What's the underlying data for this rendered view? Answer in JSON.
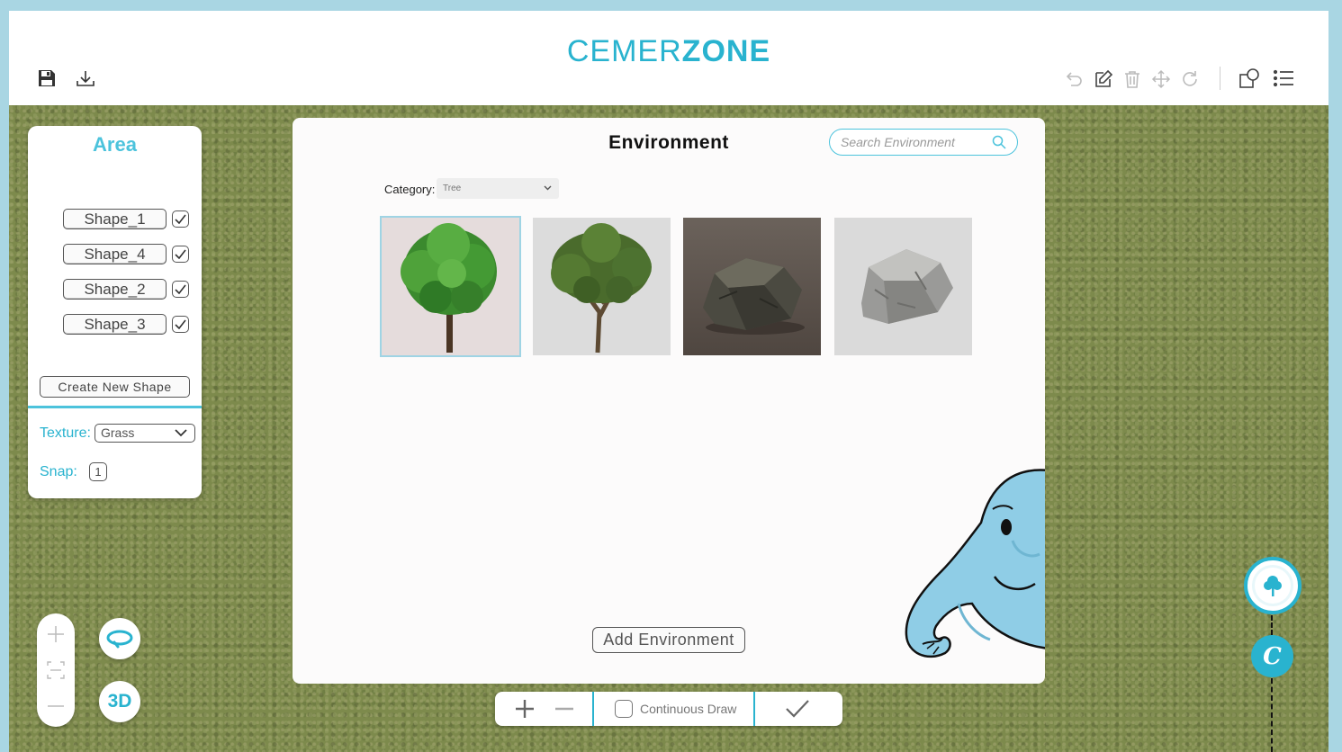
{
  "app": {
    "logo_light": "CEMER",
    "logo_bold": "ZONE",
    "accent_color": "#29b3cf",
    "ground_texture_color": "#7d8a4c"
  },
  "toolbar": {
    "left_icons": [
      "save-icon",
      "download-icon"
    ],
    "right_icons": [
      "undo-icon",
      "edit-icon",
      "delete-icon",
      "move-icon",
      "rotate-icon",
      "copy-shape-icon",
      "list-icon"
    ]
  },
  "area_panel": {
    "title": "Area",
    "shapes": [
      {
        "label": "Shape_1",
        "checked": true
      },
      {
        "label": "Shape_4",
        "checked": true
      },
      {
        "label": "Shape_2",
        "checked": true
      },
      {
        "label": "Shape_3",
        "checked": true
      }
    ],
    "create_button": "Create New Shape",
    "texture_label": "Texture:",
    "texture_value": "Grass",
    "snap_label": "Snap:",
    "snap_value": "1"
  },
  "environment_panel": {
    "title": "Environment",
    "search_placeholder": "Search Environment",
    "category_label": "Category:",
    "category_value": "Tree",
    "items": [
      {
        "name": "tree-1",
        "selected": true
      },
      {
        "name": "tree-2",
        "selected": false
      },
      {
        "name": "rock-1",
        "selected": false
      },
      {
        "name": "rock-2",
        "selected": false
      }
    ],
    "add_button": "Add Environment"
  },
  "bottom_bar": {
    "continuous_draw_label": "Continuous Draw",
    "continuous_draw_checked": false
  },
  "view_controls": {
    "mode_3d_label": "3D"
  },
  "side_modes": {
    "logo_letter": "C"
  }
}
